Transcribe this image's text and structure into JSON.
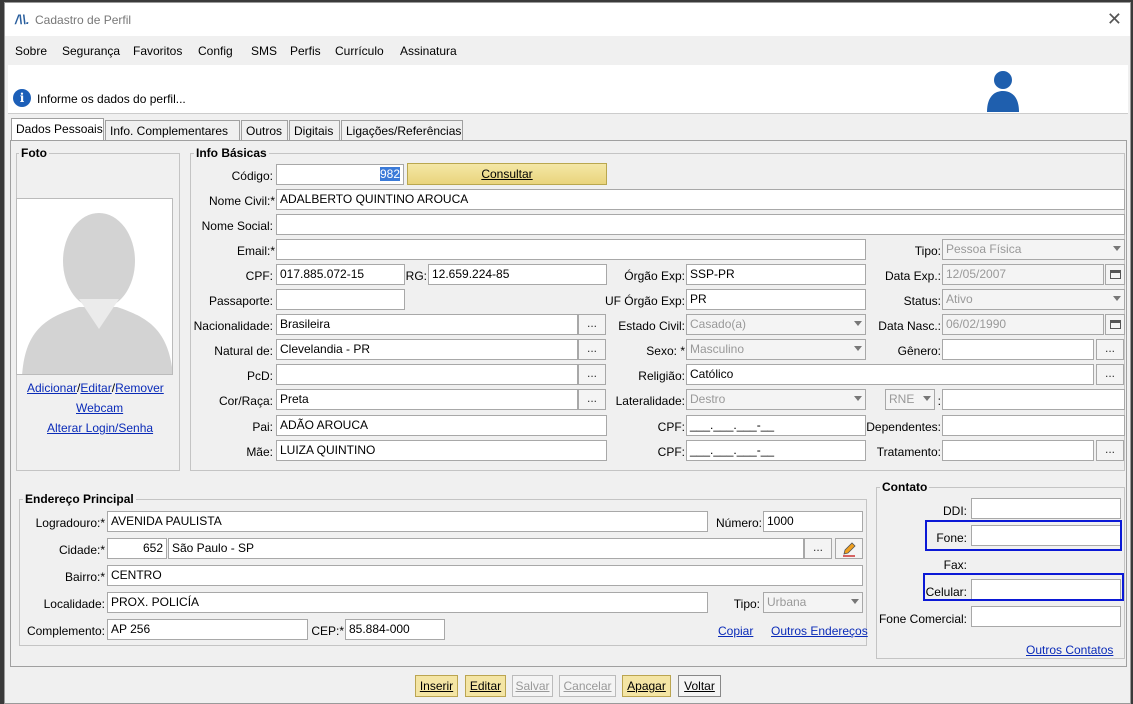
{
  "window": {
    "title": "Cadastro de Perfil"
  },
  "menu": [
    "Sobre",
    "Segurança",
    "Favoritos",
    "Config",
    "SMS",
    "Perfis",
    "Currículo",
    "Assinatura"
  ],
  "banner": {
    "message": "Informe os dados do perfil..."
  },
  "tabs": [
    "Dados Pessoais",
    "Info. Complementares",
    "Outros",
    "Digitais",
    "Ligações/Referências"
  ],
  "foto": {
    "title": "Foto",
    "adicionar": "Adicionar",
    "sep1": "/",
    "editar": "Editar",
    "sep2": "/",
    "remover": "Remover",
    "webcam": "Webcam",
    "alterar": "Alterar Login/Senha"
  },
  "info": {
    "title": "Info Básicas",
    "codigo_label": "Código:",
    "codigo": "982",
    "consultar": "Consultar",
    "nome_civil_label": "Nome Civil:*",
    "nome_civil": "ADALBERTO QUINTINO AROUCA",
    "nome_social_label": "Nome Social:",
    "nome_social": "",
    "email_label": "Email:*",
    "email": "",
    "tipo_label": "Tipo:",
    "tipo": "Pessoa Física",
    "cpf_label": "CPF:",
    "cpf": "017.885.072-15",
    "rg_label": "RG:",
    "rg": "12.659.224-85",
    "orgao_label": "Órgão Exp:",
    "orgao": "SSP-PR",
    "data_exp_label": "Data Exp.:",
    "data_exp": "12/05/2007",
    "passaporte_label": "Passaporte:",
    "passaporte": "",
    "uf_label": "UF Órgão Exp:",
    "uf": "PR",
    "status_label": "Status:",
    "status": "Ativo",
    "nacionalidade_label": "Nacionalidade:",
    "nacionalidade": "Brasileira",
    "estado_civil_label": "Estado Civil:",
    "estado_civil": "Casado(a)",
    "data_nasc_label": "Data Nasc.:",
    "data_nasc": "06/02/1990",
    "natural_label": "Natural de:",
    "natural": "Clevelandia - PR",
    "sexo_label": "Sexo: *",
    "sexo": "Masculino",
    "genero_label": "Gênero:",
    "genero": "",
    "pcd_label": "PcD:",
    "pcd": "",
    "religiao_label": "Religião:",
    "religiao": "Católico",
    "cor_label": "Cor/Raça:",
    "cor": "Preta",
    "lateralidade_label": "Lateralidade:",
    "lateralidade": "Destro",
    "rne": "RNE",
    "rne_sep": ":",
    "pai_label": "Pai:",
    "pai": "ADÃO AROUCA",
    "cpf_pai_label": "CPF:",
    "cpf_pai": "___.___.___-__",
    "dependentes_label": "Dependentes:",
    "mae_label": "Mãe:",
    "mae": "LUIZA QUINTINO",
    "cpf_mae_label": "CPF:",
    "cpf_mae": "___.___.___-__",
    "tratamento_label": "Tratamento:",
    "dots": "..."
  },
  "endereco": {
    "title": "Endereço Principal",
    "logradouro_label": "Logradouro:*",
    "logradouro": "AVENIDA PAULISTA",
    "numero_label": "Número:",
    "numero": "1000",
    "cidade_label": "Cidade:*",
    "cidade_cod": "652",
    "cidade": "São Paulo - SP",
    "bairro_label": "Bairro:*",
    "bairro": "CENTRO",
    "localidade_label": "Localidade:",
    "localidade": "PROX. POLICÍA",
    "tipo_label": "Tipo:",
    "tipo": "Urbana",
    "complemento_label": "Complemento:",
    "complemento": "AP 256",
    "cep_label": "CEP:*",
    "cep": "85.884-000",
    "copiar": "Copiar",
    "outros": "Outros Endereços"
  },
  "contato": {
    "title": "Contato",
    "ddi_label": "DDI:",
    "fone_label": "Fone:",
    "fax_label": "Fax:",
    "celular_label": "Celular:",
    "fone_comercial_label": "Fone Comercial:",
    "outros": "Outros Contatos"
  },
  "buttons": {
    "inserir": "Inserir",
    "editar": "Editar",
    "salvar": "Salvar",
    "cancelar": "Cancelar",
    "apagar": "Apagar",
    "voltar": "Voltar"
  },
  "colors": {
    "highlight": "#0b19d6",
    "button_yellow": "#f4e5a4",
    "link": "#0a2bb8"
  }
}
